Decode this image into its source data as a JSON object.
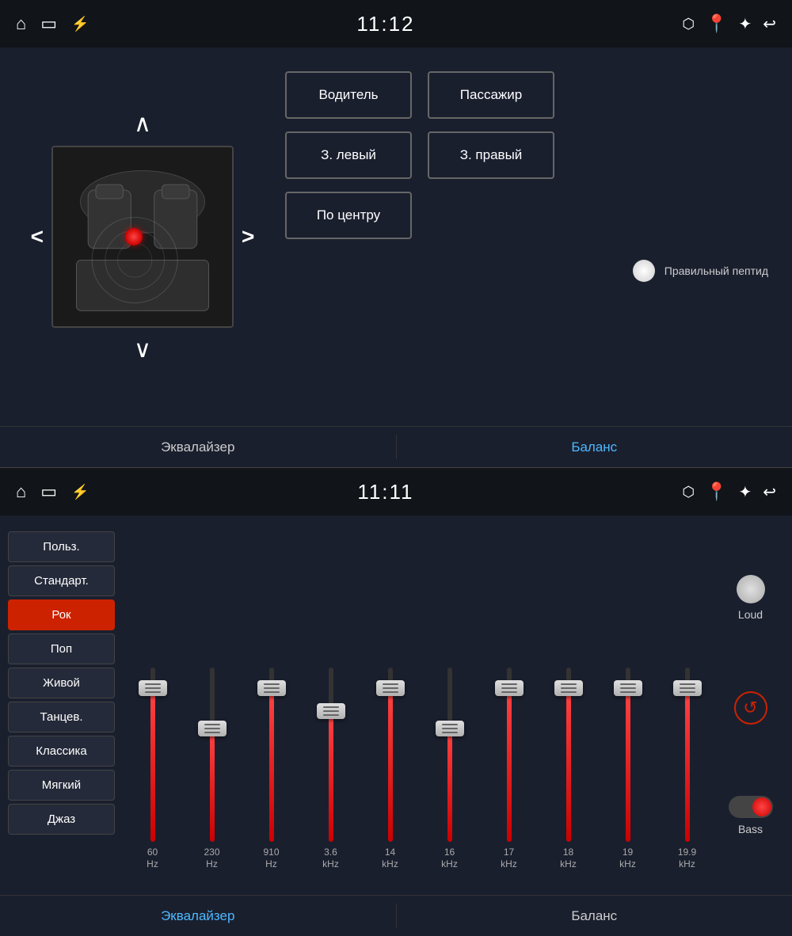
{
  "top_panel": {
    "status_bar": {
      "time": "11:12",
      "icons_left": [
        "home-icon",
        "screen-icon",
        "usb-icon"
      ],
      "icons_right": [
        "cast-icon",
        "location-icon",
        "bluetooth-icon",
        "back-icon"
      ]
    },
    "zone_buttons": [
      {
        "id": "driver",
        "label": "Водитель"
      },
      {
        "id": "passenger",
        "label": "Пассажир"
      },
      {
        "id": "rear-left",
        "label": "З. левый"
      },
      {
        "id": "rear-right",
        "label": "З. правый"
      },
      {
        "id": "center",
        "label": "По центру"
      }
    ],
    "peptide_label": "Правильный пептид",
    "tabs": [
      {
        "id": "equalizer-tab-top",
        "label": "Эквалайзер",
        "active": false
      },
      {
        "id": "balance-tab-top",
        "label": "Баланс",
        "active": true
      }
    ]
  },
  "bottom_panel": {
    "status_bar": {
      "time": "11:11"
    },
    "presets": [
      {
        "id": "user",
        "label": "Польз.",
        "selected": false
      },
      {
        "id": "standard",
        "label": "Стандарт.",
        "selected": false
      },
      {
        "id": "rock",
        "label": "Рок",
        "selected": true
      },
      {
        "id": "pop",
        "label": "Поп",
        "selected": false
      },
      {
        "id": "live",
        "label": "Живой",
        "selected": false
      },
      {
        "id": "dance",
        "label": "Танцев.",
        "selected": false
      },
      {
        "id": "classic",
        "label": "Классика",
        "selected": false
      },
      {
        "id": "soft",
        "label": "Мягкий",
        "selected": false
      },
      {
        "id": "jazz",
        "label": "Джаз",
        "selected": false
      }
    ],
    "eq_bands": [
      {
        "freq": "60",
        "unit": "Hz",
        "fill_pct": 88,
        "thumb_pct": 88
      },
      {
        "freq": "230",
        "unit": "Hz",
        "fill_pct": 65,
        "thumb_pct": 65
      },
      {
        "freq": "910",
        "unit": "Hz",
        "fill_pct": 88,
        "thumb_pct": 88
      },
      {
        "freq": "3.6",
        "unit": "kHz",
        "fill_pct": 75,
        "thumb_pct": 75
      },
      {
        "freq": "14",
        "unit": "kHz",
        "fill_pct": 88,
        "thumb_pct": 88
      },
      {
        "freq": "16",
        "unit": "kHz",
        "fill_pct": 65,
        "thumb_pct": 65
      },
      {
        "freq": "17",
        "unit": "kHz",
        "fill_pct": 88,
        "thumb_pct": 88
      },
      {
        "freq": "18",
        "unit": "kHz",
        "fill_pct": 88,
        "thumb_pct": 88
      },
      {
        "freq": "19",
        "unit": "kHz",
        "fill_pct": 88,
        "thumb_pct": 88
      },
      {
        "freq": "19.9",
        "unit": "kHz",
        "fill_pct": 88,
        "thumb_pct": 88
      }
    ],
    "controls": {
      "loud_label": "Loud",
      "reset_icon": "↺",
      "bass_label": "Bass"
    },
    "tabs": [
      {
        "id": "equalizer-tab-bottom",
        "label": "Эквалайзер",
        "active": true
      },
      {
        "id": "balance-tab-bottom",
        "label": "Баланс",
        "active": false
      }
    ]
  }
}
